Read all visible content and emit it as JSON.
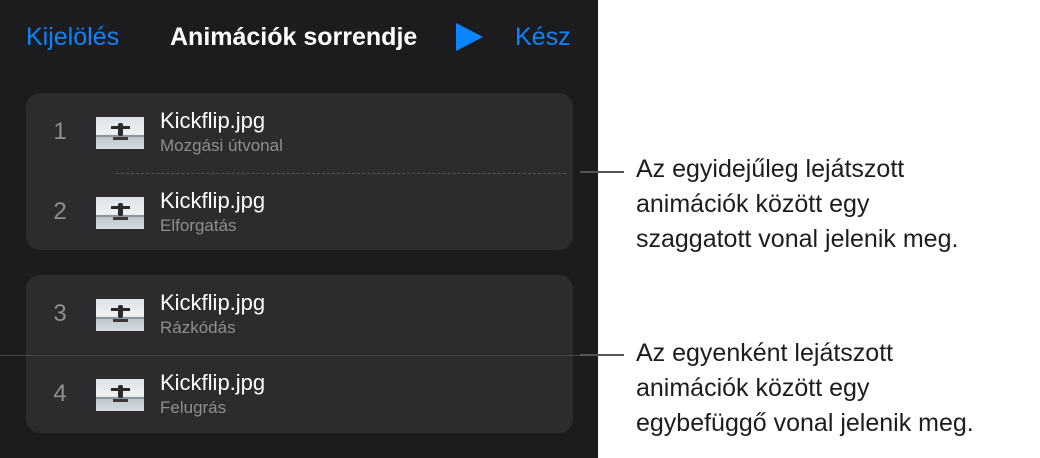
{
  "nav": {
    "select_label": "Kijelölés",
    "title": "Animációk sorrendje",
    "done_label": "Kész"
  },
  "groups": [
    {
      "rows": [
        {
          "number": "1",
          "file": "Kickflip.jpg",
          "effect": "Mozgási útvonal"
        },
        {
          "number": "2",
          "file": "Kickflip.jpg",
          "effect": "Elforgatás"
        }
      ]
    },
    {
      "rows": [
        {
          "number": "3",
          "file": "Kickflip.jpg",
          "effect": "Rázkódás"
        },
        {
          "number": "4",
          "file": "Kickflip.jpg",
          "effect": "Felugrás"
        }
      ]
    }
  ],
  "callouts": {
    "dashed": {
      "line1": "Az egyidejűleg lejátszott",
      "line2": "animációk között egy",
      "line3": "szaggatott vonal jelenik meg."
    },
    "solid": {
      "line1": "Az egyenként lejátszott",
      "line2": "animációk között egy",
      "line3": "egybefüggő vonal jelenik meg."
    }
  },
  "colors": {
    "accent": "#0a84ff",
    "panel_bg": "#1c1c1e",
    "row_bg": "#2c2c2e"
  }
}
